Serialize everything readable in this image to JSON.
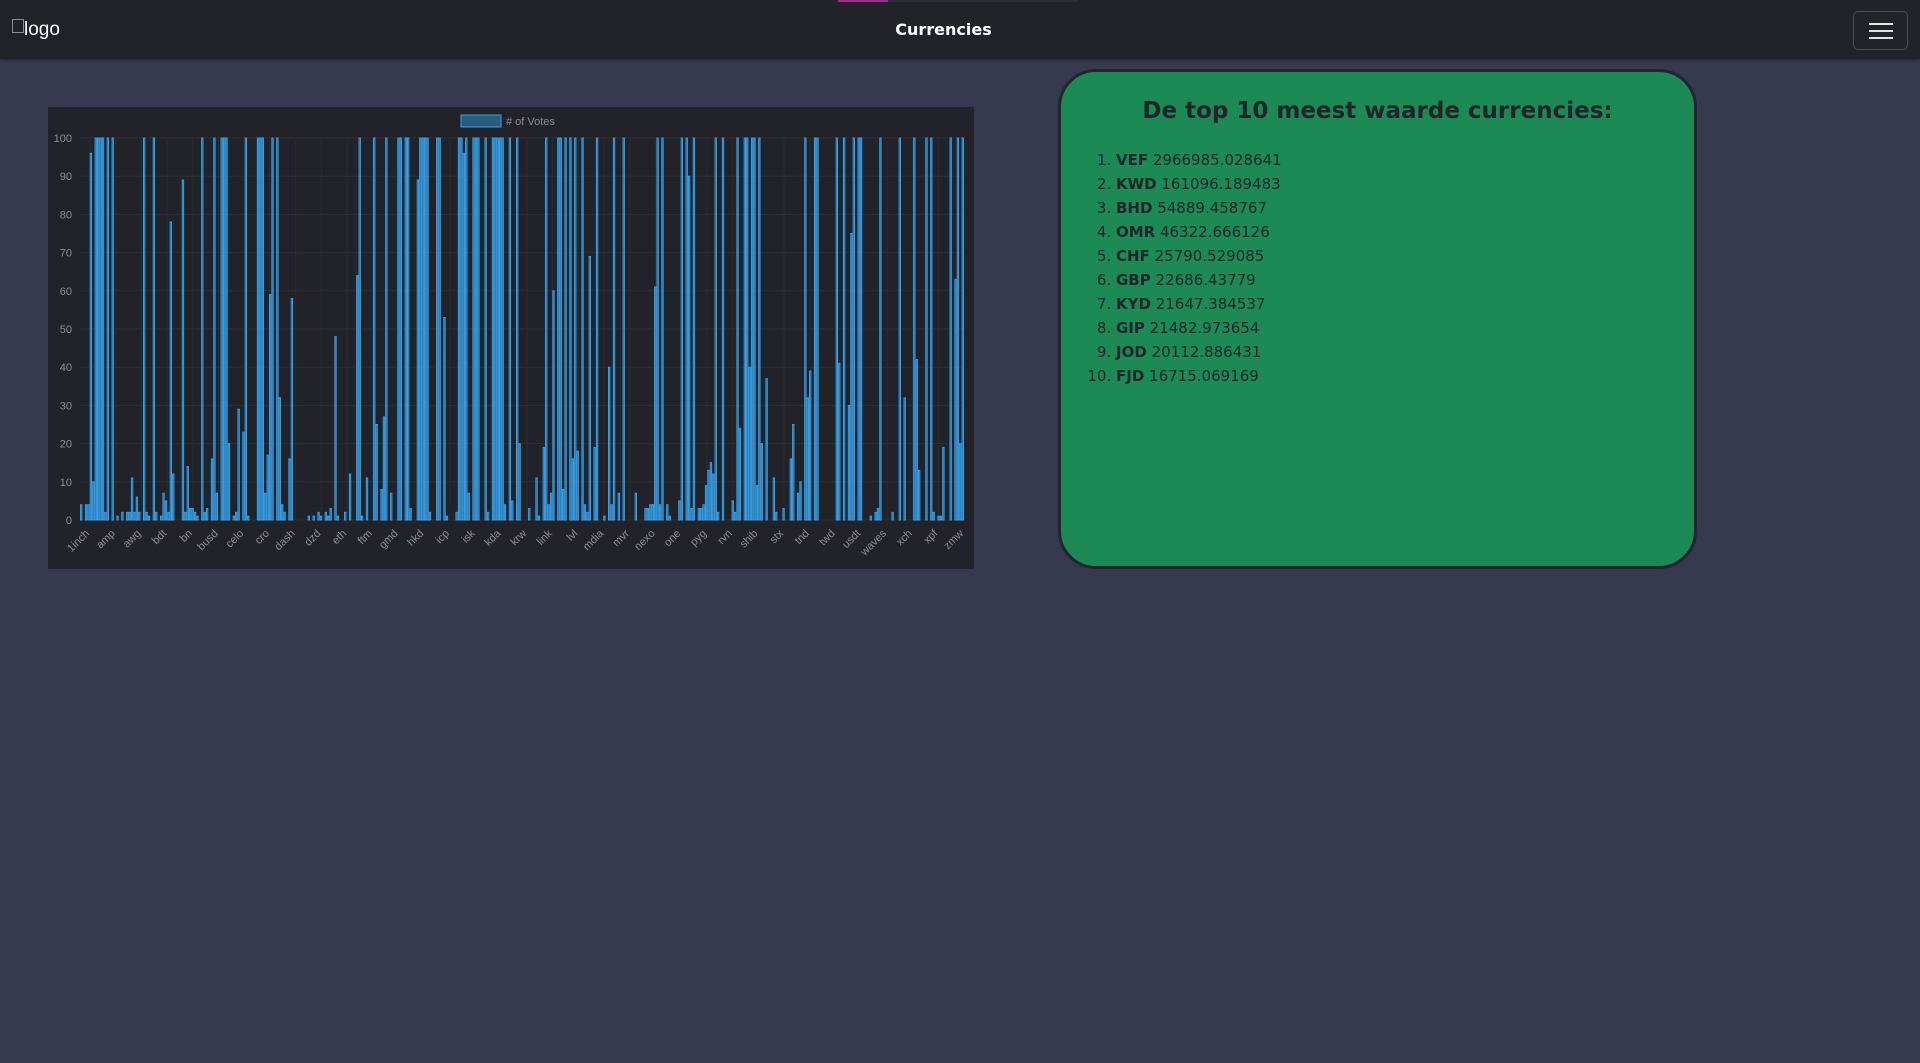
{
  "navbar": {
    "logo_alt": "logo",
    "title": "Currencies",
    "menu_icon": "hamburger-menu-icon"
  },
  "top10": {
    "heading": "De top 10 meest waarde currencies:",
    "items": [
      {
        "code": "VEF",
        "value": "2966985.028641"
      },
      {
        "code": "KWD",
        "value": "161096.189483"
      },
      {
        "code": "BHD",
        "value": "54889.458767"
      },
      {
        "code": "OMR",
        "value": "46322.666126"
      },
      {
        "code": "CHF",
        "value": "25790.529085"
      },
      {
        "code": "GBP",
        "value": "22686.43779"
      },
      {
        "code": "KYD",
        "value": "21647.384537"
      },
      {
        "code": "GIP",
        "value": "21482.973654"
      },
      {
        "code": "JOD",
        "value": "20112.886431"
      },
      {
        "code": "FJD",
        "value": "16715.069169"
      }
    ]
  },
  "colors": {
    "background": "#373a4f",
    "navbar": "#212329",
    "chart_bg": "#212329",
    "bar": "#36a2eb",
    "card": "#1b8a55"
  },
  "chart_data": {
    "type": "bar",
    "legend": "# of Votes",
    "legend_position": "top",
    "ylim": [
      0,
      100
    ],
    "yticks": [
      0,
      10,
      20,
      30,
      40,
      50,
      60,
      70,
      80,
      90,
      100
    ],
    "grid": true,
    "tick_labels": [
      "1inch",
      "amp",
      "awg",
      "bdt",
      "bn",
      "busd",
      "celo",
      "cro",
      "dash",
      "dzd",
      "eth",
      "ftm",
      "gmd",
      "hkd",
      "icp",
      "isk",
      "kda",
      "krw",
      "link",
      "lvl",
      "mdia",
      "mvr",
      "nexo",
      "one",
      "pyg",
      "rvn",
      "shib",
      "stx",
      "tnd",
      "twd",
      "usdt",
      "waves",
      "xch",
      "xpf",
      "zmw"
    ],
    "values": [
      4,
      0,
      4,
      4,
      96,
      10,
      100,
      100,
      100,
      100,
      2,
      100,
      0,
      100,
      0,
      1,
      0,
      2,
      0,
      2,
      2,
      11,
      2,
      6,
      2,
      0,
      100,
      2,
      1,
      0,
      100,
      2,
      0,
      1,
      7,
      5,
      2,
      78,
      12,
      0,
      0,
      0,
      89,
      2,
      14,
      3,
      3,
      2,
      1,
      0,
      100,
      2,
      3,
      0,
      16,
      100,
      7,
      0,
      100,
      100,
      100,
      20,
      0,
      1,
      2,
      29,
      0,
      23,
      100,
      1,
      0,
      0,
      0,
      100,
      100,
      100,
      7,
      17,
      59,
      100,
      0,
      100,
      32,
      4,
      2,
      0,
      16,
      58,
      0,
      0,
      0,
      0,
      0,
      0,
      1,
      0,
      1,
      0,
      2,
      1,
      0,
      2,
      1,
      3,
      0,
      48,
      1,
      0,
      0,
      2,
      0,
      12,
      0,
      0,
      64,
      100,
      1,
      0,
      11,
      0,
      0,
      100,
      25,
      0,
      8,
      27,
      100,
      0,
      7,
      0,
      0,
      100,
      100,
      0,
      100,
      100,
      3,
      0,
      0,
      89,
      100,
      100,
      100,
      100,
      2,
      0,
      0,
      100,
      100,
      0,
      53,
      1,
      0,
      0,
      0,
      2,
      100,
      100,
      96,
      100,
      7,
      0,
      100,
      100,
      100,
      0,
      0,
      100,
      2,
      0,
      100,
      100,
      100,
      100,
      100,
      4,
      0,
      100,
      5,
      0,
      100,
      20,
      0,
      0,
      0,
      3,
      0,
      0,
      11,
      1,
      0,
      19,
      100,
      4,
      7,
      60,
      0,
      100,
      100,
      8,
      100,
      0,
      100,
      16,
      100,
      18,
      0,
      100,
      4,
      2,
      69,
      0,
      19,
      100,
      0,
      0,
      1,
      0,
      40,
      4,
      100,
      0,
      7,
      0,
      100,
      0,
      0,
      0,
      0,
      7,
      0,
      0,
      0,
      3,
      3,
      4,
      4,
      61,
      100,
      4,
      100,
      0,
      4,
      1,
      0,
      0,
      0,
      5,
      100,
      0,
      100,
      90,
      3,
      100,
      0,
      3,
      3,
      4,
      9,
      13,
      15,
      12,
      100,
      2,
      0,
      100,
      0,
      0,
      0,
      5,
      2,
      100,
      24,
      0,
      100,
      100,
      40,
      100,
      100,
      9,
      100,
      20,
      0,
      37,
      0,
      0,
      11,
      2,
      0,
      0,
      3,
      0,
      0,
      16,
      25,
      0,
      7,
      10,
      0,
      100,
      32,
      39,
      0,
      100,
      100,
      0,
      0,
      0,
      0,
      0,
      0,
      0,
      100,
      41,
      0,
      100,
      0,
      30,
      75,
      100,
      0,
      100,
      100,
      0,
      0,
      0,
      1,
      0,
      2,
      3,
      100,
      0,
      0,
      0,
      0,
      2,
      0,
      0,
      100,
      0,
      32,
      0,
      0,
      0,
      100,
      42,
      13,
      0,
      0,
      100,
      0,
      100,
      2,
      0,
      1,
      1,
      19,
      0,
      0,
      100,
      0,
      63,
      100,
      20,
      100
    ]
  }
}
